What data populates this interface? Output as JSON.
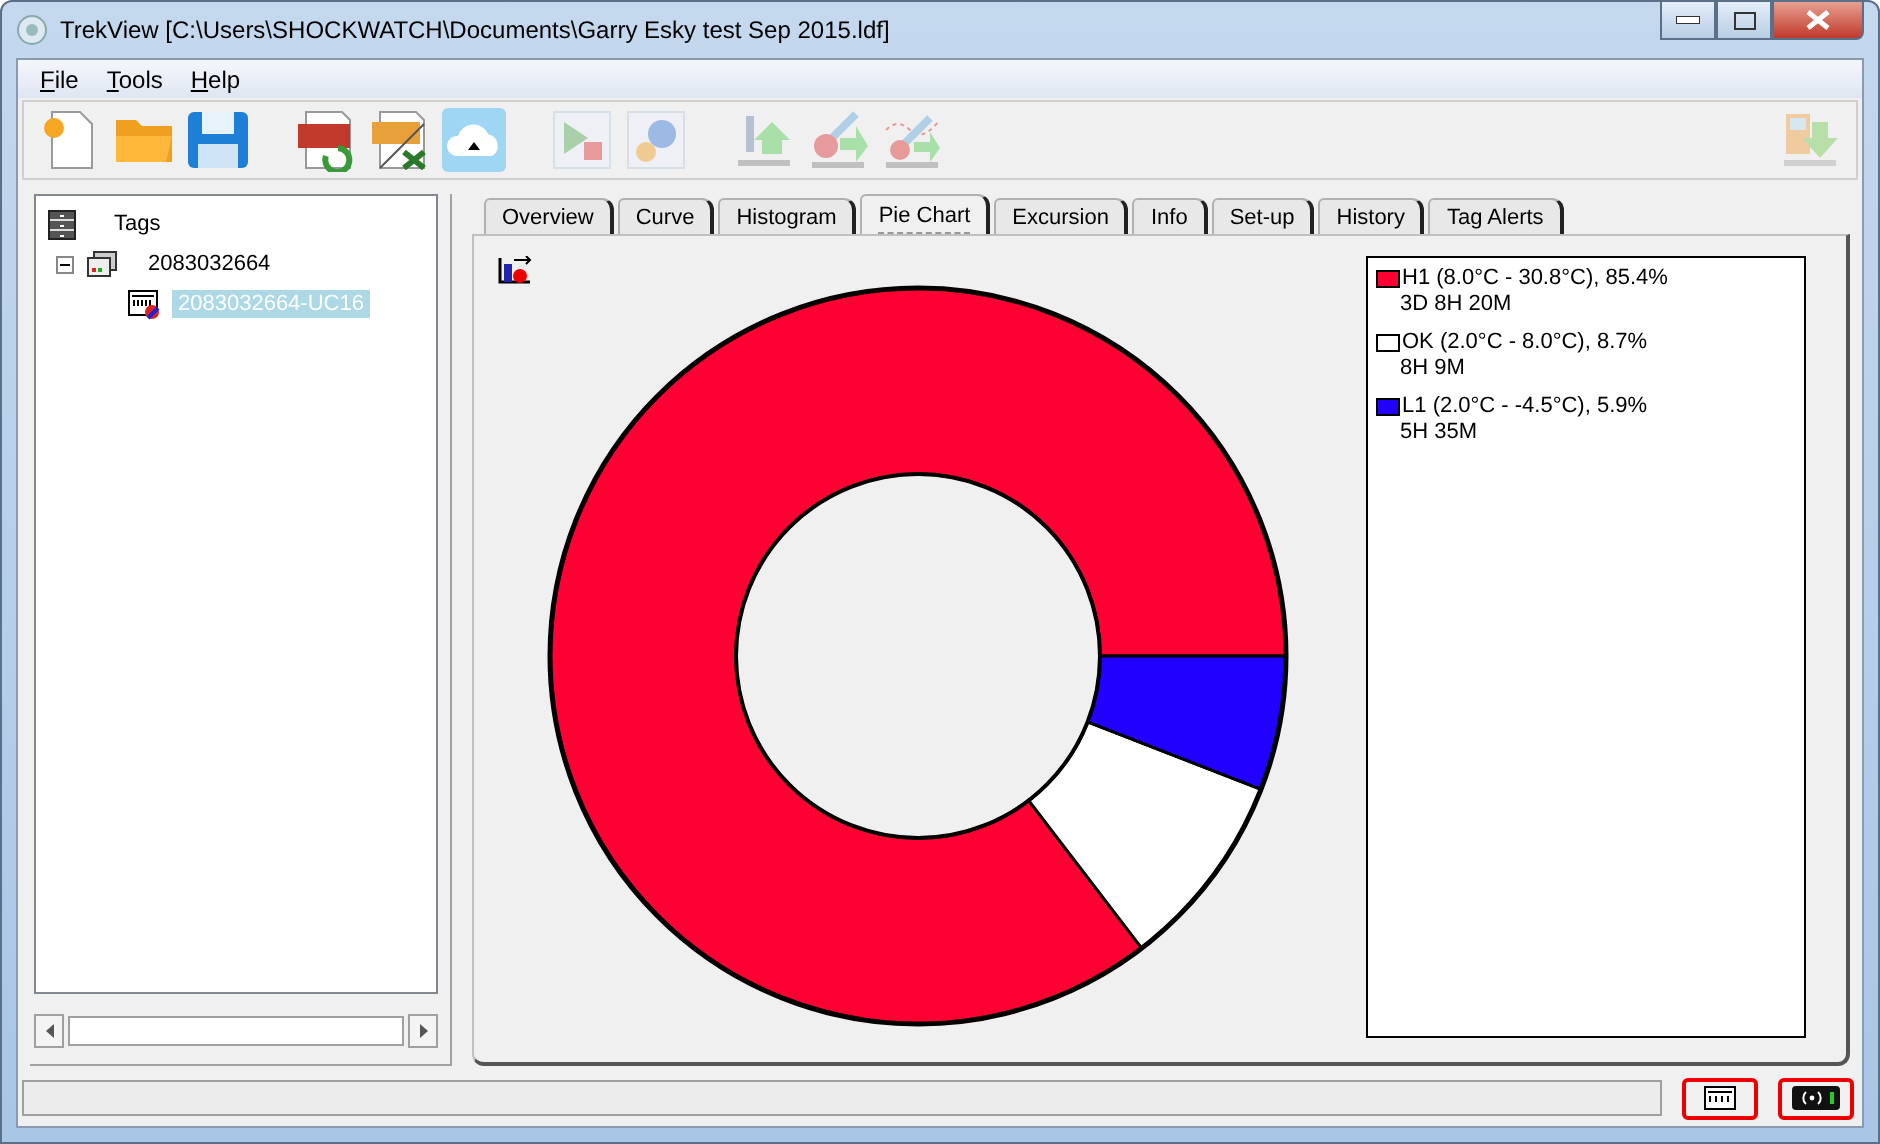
{
  "window": {
    "title": "TrekView [C:\\Users\\SHOCKWATCH\\Documents\\Garry Esky test Sep 2015.ldf]"
  },
  "menu": [
    {
      "label": "File"
    },
    {
      "label": "Tools"
    },
    {
      "label": "Help"
    }
  ],
  "toolbar": [
    {
      "kind": "new",
      "disabled": false
    },
    {
      "kind": "open",
      "disabled": false
    },
    {
      "kind": "save",
      "disabled": false
    },
    {
      "kind": "sep"
    },
    {
      "kind": "pdf",
      "disabled": false
    },
    {
      "kind": "csv",
      "disabled": false
    },
    {
      "kind": "cloud",
      "disabled": false
    },
    {
      "kind": "sep"
    },
    {
      "kind": "play",
      "disabled": true
    },
    {
      "kind": "gears",
      "disabled": true
    },
    {
      "kind": "sep"
    },
    {
      "kind": "upload",
      "disabled": true
    },
    {
      "kind": "thermo",
      "disabled": true
    },
    {
      "kind": "thermochart",
      "disabled": true
    },
    {
      "kind": "spacer"
    },
    {
      "kind": "download",
      "disabled": true
    }
  ],
  "tree": {
    "label": "Tags",
    "children": [
      {
        "label": "2083032664",
        "expanded": true,
        "selected": false,
        "children": [
          {
            "label": "2083032664-UC16",
            "selected": true
          }
        ]
      }
    ]
  },
  "tabs": [
    {
      "label": "Overview",
      "selected": false
    },
    {
      "label": "Curve",
      "selected": false
    },
    {
      "label": "Histogram",
      "selected": false
    },
    {
      "label": "Pie Chart",
      "selected": true
    },
    {
      "label": "Excursion",
      "selected": false
    },
    {
      "label": "Info",
      "selected": false
    },
    {
      "label": "Set-up",
      "selected": false
    },
    {
      "label": "History",
      "selected": false
    },
    {
      "label": "Tag Alerts",
      "selected": false
    }
  ],
  "chart_data": {
    "type": "donut",
    "categories": [
      "H1",
      "OK",
      "L1"
    ],
    "values": [
      85.4,
      8.7,
      5.9
    ]
  },
  "legend": [
    {
      "range": "(8.0°C  -  30.8°C), 85.4%",
      "duration": "3D 8H 20M",
      "color": "#ff0033"
    },
    {
      "range": "(2.0°C  -  8.0°C), 8.7%",
      "duration": "8H 9M",
      "color": "#ffffff"
    },
    {
      "range": "(2.0°C  -  -4.5°C), 5.9%",
      "duration": "5H 35M",
      "color": "#2200ff"
    }
  ]
}
